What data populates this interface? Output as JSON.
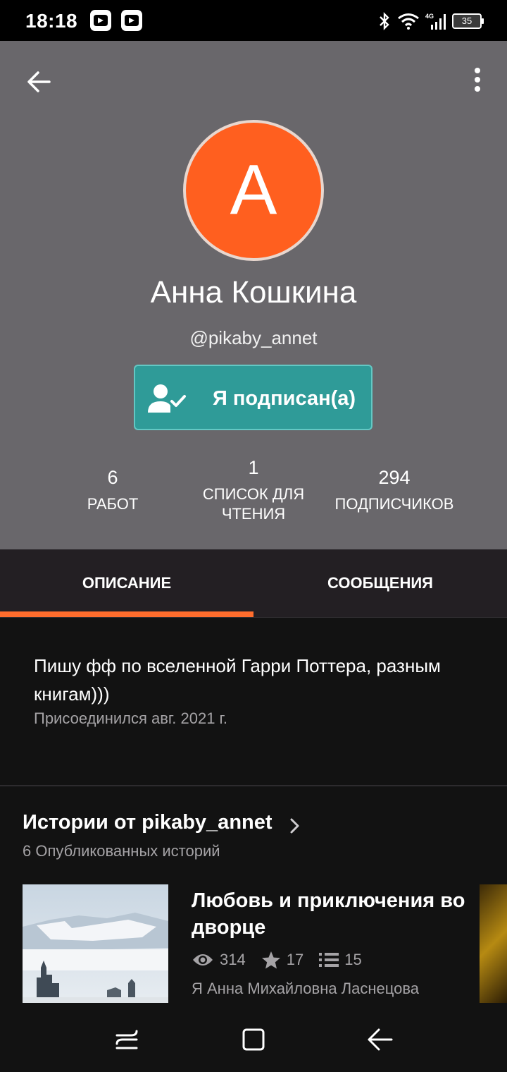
{
  "status_bar": {
    "time": "18:18",
    "battery": "35"
  },
  "profile": {
    "avatar_letter": "A",
    "name": "Анна Кошкина",
    "handle": "@pikaby_annet",
    "follow_button": "Я подписан(а)",
    "stats": [
      {
        "value": "6",
        "label": "РАБОТ"
      },
      {
        "value": "1",
        "label": "СПИСОК ДЛЯ ЧТЕНИЯ"
      },
      {
        "value": "294",
        "label": "ПОДПИСЧИКОВ"
      }
    ]
  },
  "tabs": [
    {
      "label": "ОПИСАНИЕ",
      "active": true
    },
    {
      "label": "СООБЩЕНИЯ",
      "active": false
    }
  ],
  "about": {
    "description": "Пишу фф по вселенной Гарри Поттера, разным книгам)))",
    "joined": "Присоединился авг. 2021 г."
  },
  "stories_section": {
    "title": "Истории от pikaby_annet",
    "count": "6 Опубликованных историй",
    "stories": [
      {
        "title": "Любовь и приключения во дворце",
        "reads": "314",
        "votes": "17",
        "parts": "15",
        "author": "Я Анна Михайловна Ласнецова"
      }
    ]
  },
  "colors": {
    "header_bg": "#69676b",
    "avatar_bg": "#ff5f1f",
    "follow_bg": "#2f9b98",
    "tab_indicator": "#ff6d2d",
    "page_bg": "#121212"
  },
  "icons": {
    "back": "arrow-left-icon",
    "more": "more-vertical-icon",
    "follow": "person-check-icon",
    "reads": "eye-icon",
    "votes": "star-icon",
    "parts": "list-icon"
  }
}
